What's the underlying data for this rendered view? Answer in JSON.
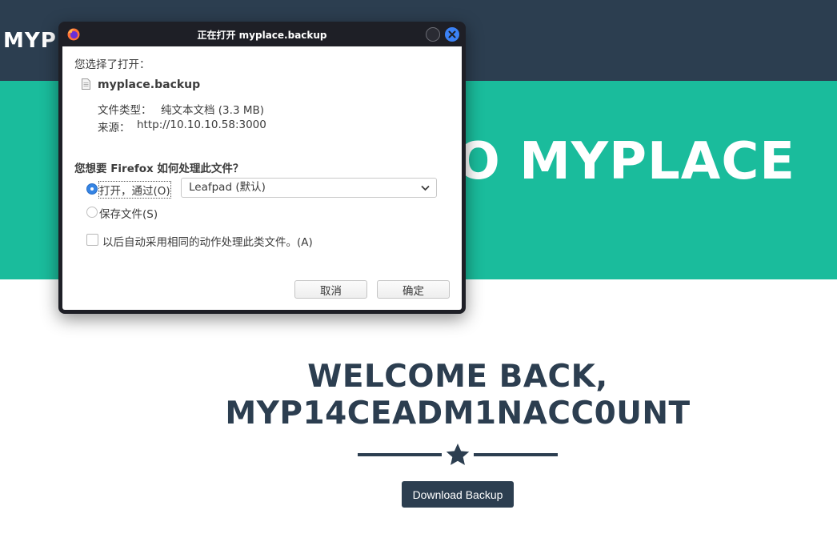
{
  "page": {
    "brand": "MYPLACE",
    "hero_title": "WELCOME TO MYPLACE",
    "welcome_line1": "WELCOME BACK,",
    "welcome_line2": "MYP14CEADM1NACC0UNT",
    "download_button": "Download Backup",
    "colors": {
      "navbar": "#2c3e50",
      "hero": "#1abc9c",
      "text": "#2c3e50"
    }
  },
  "dialog": {
    "title": "正在打开 myplace.backup",
    "chose_to_open": "您选择了打开：",
    "filename": "myplace.backup",
    "file_type_label": "文件类型：",
    "file_type_value": "纯文本文档 (3.3 MB)",
    "source_label": "来源：",
    "source_value": "http://10.10.10.58:3000",
    "question": "您想要 Firefox 如何处理此文件？",
    "open_with_label": "打开，通过(O)",
    "open_with_app": "Leafpad (默认)",
    "save_file_label": "保存文件(S)",
    "auto_action_label": "以后自动采用相同的动作处理此类文件。(A)",
    "cancel": "取消",
    "ok": "确定",
    "icons": [
      "firefox-icon",
      "minimize-icon",
      "close-icon",
      "file-icon",
      "chevron-down-icon",
      "star-icon"
    ]
  }
}
